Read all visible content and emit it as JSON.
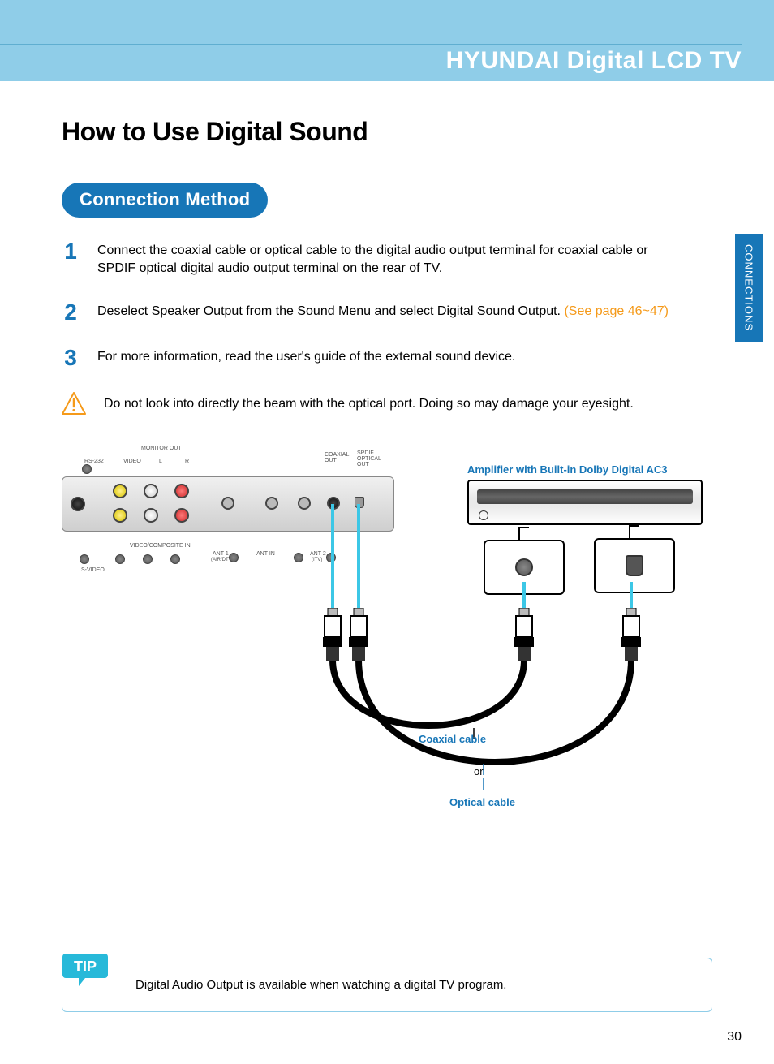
{
  "header": {
    "product_line": "HYUNDAI Digital LCD TV"
  },
  "side_tab": "CONNECTIONS",
  "page_title": "How to Use Digital Sound",
  "section_pill": "Connection Method",
  "steps": [
    {
      "num": "1",
      "text": "Connect the coaxial cable or optical cable to the digital audio output terminal for coaxial cable or SPDIF optical digital audio output terminal on the rear of TV."
    },
    {
      "num": "2",
      "text": "Deselect Speaker Output from the Sound Menu and select Digital Sound Output.",
      "ref": " (See page 46~47)"
    },
    {
      "num": "3",
      "text": "For more information, read the user's guide of the external sound device."
    }
  ],
  "warning": "Do not look into directly the beam with the optical port. Doing so may damage your eyesight.",
  "diagram": {
    "tv_labels": {
      "rs232": "RS-232",
      "monitor_out": "MONITOR OUT",
      "video": "VIDEO",
      "l": "L",
      "r": "R",
      "svideo": "S-VIDEO",
      "video_composite_in": "VIDEO/COMPOSITE IN",
      "ant1": "ANT 1",
      "ant1_sub": "(AIR/DTV)",
      "ant_in": "ANT IN",
      "ant2": "ANT 2",
      "ant2_sub": "(ITV)",
      "coaxial_out": "COAXIAL\nOUT",
      "spdif": "SPDIF\nOPTICAL\nOUT"
    },
    "amp_label": "Amplifier with Built-in Dolby Digital AC3",
    "coax_cable": "Coaxial cable",
    "optical_cable": "Optical cable",
    "or": "or"
  },
  "tip": {
    "badge": "TIP",
    "text": "Digital Audio Output is available when watching a digital TV program."
  },
  "page_number": "30"
}
